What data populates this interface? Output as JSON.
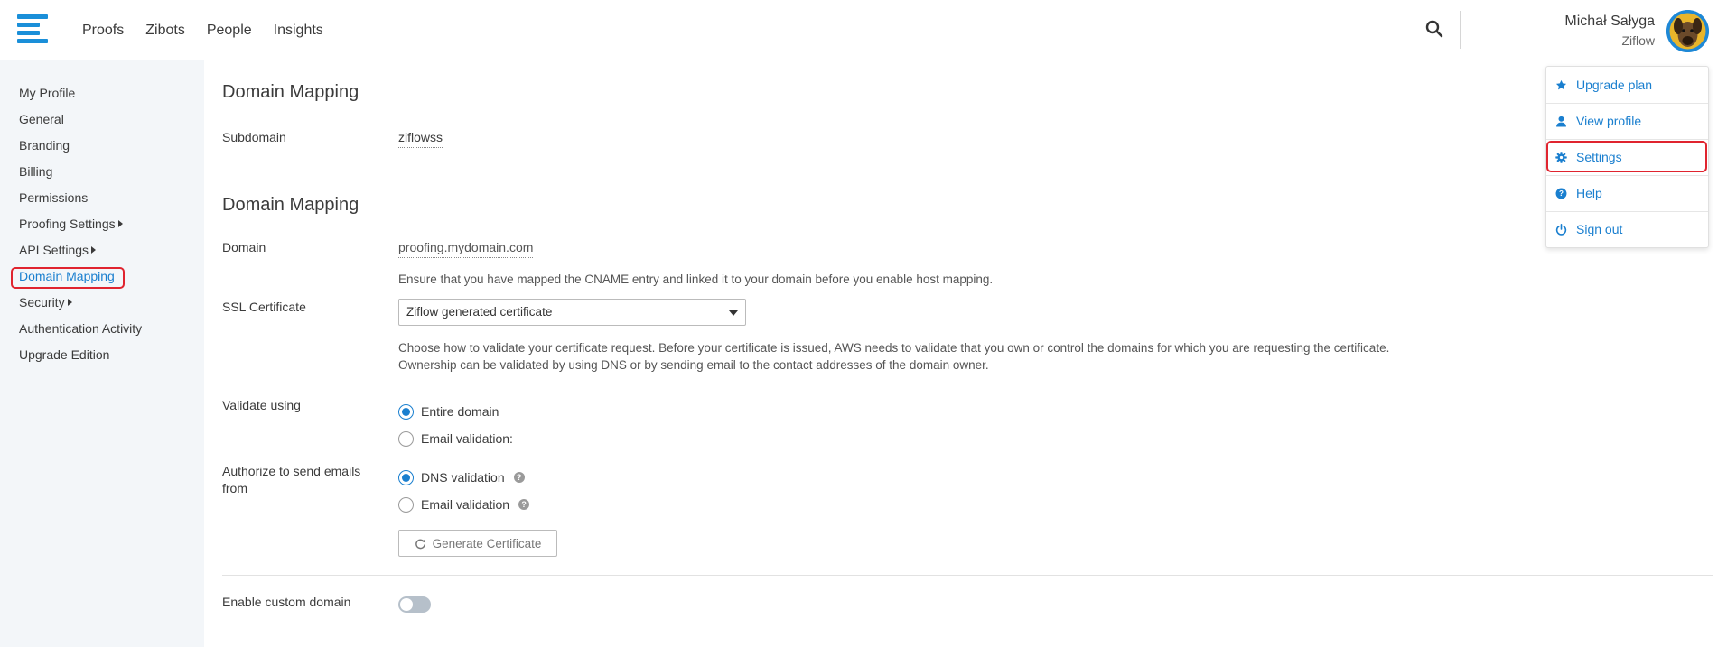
{
  "nav": {
    "items": [
      "Proofs",
      "Zibots",
      "People",
      "Insights"
    ]
  },
  "user": {
    "name": "Michał Sałyga",
    "org": "Ziflow"
  },
  "sidebar": {
    "items": [
      {
        "label": "My Profile"
      },
      {
        "label": "General"
      },
      {
        "label": "Branding"
      },
      {
        "label": "Billing"
      },
      {
        "label": "Permissions"
      },
      {
        "label": "Proofing Settings"
      },
      {
        "label": "API Settings"
      },
      {
        "label": "Domain Mapping"
      },
      {
        "label": "Security"
      },
      {
        "label": "Authentication Activity"
      },
      {
        "label": "Upgrade Edition"
      }
    ]
  },
  "section1": {
    "title": "Domain Mapping",
    "subdomain_label": "Subdomain",
    "subdomain_value": "ziflowss"
  },
  "section2": {
    "title": "Domain Mapping",
    "domain_label": "Domain",
    "domain_placeholder": "proofing.mydomain.com",
    "domain_help": "Ensure that you have mapped the CNAME entry and linked it to your domain before you enable host mapping.",
    "ssl_label": "SSL Certificate",
    "ssl_value": "Ziflow generated certificate",
    "ssl_help_line1": "Choose how to validate your certificate request. Before your certificate is issued, AWS needs to validate that you own or control the domains for which you are requesting the certificate.",
    "ssl_help_line2": "Ownership can be validated by using DNS or by sending email to the contact addresses of the domain owner.",
    "validate_label": "Validate using",
    "validate_options": [
      "Entire domain",
      "Email validation:"
    ],
    "authorize_label_line1": "Authorize to send emails",
    "authorize_label_line2": "from",
    "authorize_options": [
      "DNS validation",
      "Email validation"
    ],
    "generate_button": "Generate Certificate"
  },
  "section3": {
    "custom_domain_label": "Enable custom domain"
  },
  "dropdown": {
    "items": [
      {
        "label": "Upgrade plan",
        "icon": "star-icon"
      },
      {
        "label": "View profile",
        "icon": "user-icon"
      },
      {
        "label": "Settings",
        "icon": "gear-icon"
      },
      {
        "label": "Help",
        "icon": "question-icon"
      },
      {
        "label": "Sign out",
        "icon": "power-icon"
      }
    ]
  },
  "colors": {
    "accent": "#1a7fcf",
    "highlight": "#e0242f",
    "sidebar_bg": "#f3f6f9"
  }
}
